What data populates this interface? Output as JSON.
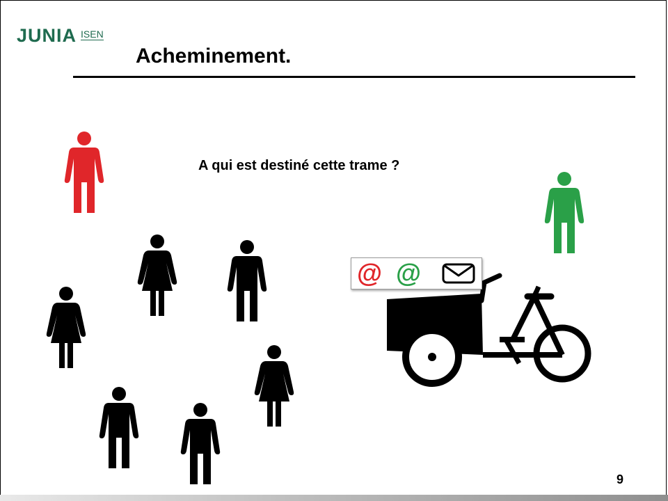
{
  "logo": {
    "junia": "JUNIA",
    "isen": "ISEN",
    "color": "#1f6b4f"
  },
  "slide": {
    "title": "Acheminement.",
    "question": "A qui est destiné cette trame ?",
    "page_number": "9"
  },
  "packet": {
    "source_at": "@",
    "destination_at": "@",
    "source_color": "#e0262a",
    "destination_color": "#2aa048",
    "icon": "envelope-icon"
  },
  "colors": {
    "sender": "#e0262a",
    "receiver": "#2aa048",
    "bystanders": "#000000"
  }
}
